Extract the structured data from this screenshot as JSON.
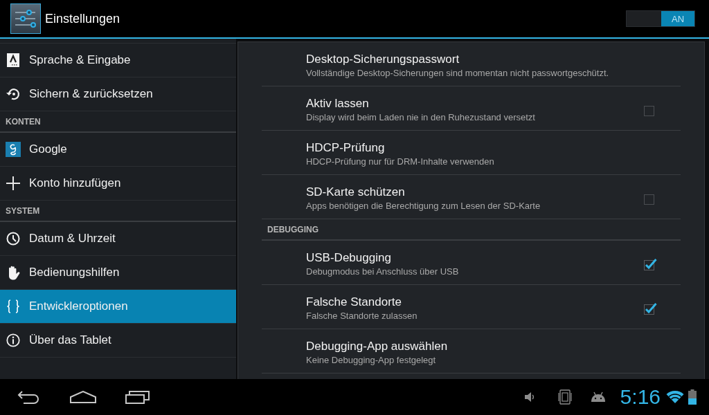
{
  "action_bar": {
    "title": "Einstellungen",
    "switch": {
      "label": "AN",
      "on": true
    }
  },
  "sidebar": {
    "items": [
      {
        "kind": "item",
        "label": "Sprache & Eingabe",
        "selected": false
      },
      {
        "kind": "item",
        "label": "Sichern & zurücksetzen",
        "selected": false
      },
      {
        "kind": "header",
        "label": "KONTEN"
      },
      {
        "kind": "item",
        "label": "Google",
        "selected": false
      },
      {
        "kind": "item",
        "label": "Konto hinzufügen",
        "selected": false
      },
      {
        "kind": "header",
        "label": "SYSTEM"
      },
      {
        "kind": "item",
        "label": "Datum & Uhrzeit",
        "selected": false
      },
      {
        "kind": "item",
        "label": "Bedienungshilfen",
        "selected": false
      },
      {
        "kind": "item",
        "label": "Entwickleroptionen",
        "selected": true
      },
      {
        "kind": "item",
        "label": "Über das Tablet",
        "selected": false
      }
    ]
  },
  "details": {
    "items": [
      {
        "kind": "action",
        "title": "Desktop-Sicherungspasswort",
        "summary": "Vollständige Desktop-Sicherungen sind momentan nicht passwortgeschützt."
      },
      {
        "kind": "checkbox",
        "title": "Aktiv lassen",
        "summary": "Display wird beim Laden nie in den Ruhezustand versetzt",
        "checked": false
      },
      {
        "kind": "action",
        "title": "HDCP-Prüfung",
        "summary": "HDCP-Prüfung nur für DRM-Inhalte verwenden"
      },
      {
        "kind": "checkbox",
        "title": "SD-Karte schützen",
        "summary": "Apps benötigen die Berechtigung zum Lesen der SD-Karte",
        "checked": false
      },
      {
        "kind": "header",
        "label": "DEBUGGING"
      },
      {
        "kind": "checkbox",
        "title": "USB-Debugging",
        "summary": "Debugmodus bei Anschluss über USB",
        "checked": true
      },
      {
        "kind": "checkbox",
        "title": "Falsche Standorte",
        "summary": "Falsche Standorte zulassen",
        "checked": true
      },
      {
        "kind": "action",
        "title": "Debugging-App auswählen",
        "summary": "Keine Debugging-App festgelegt"
      }
    ]
  },
  "navigation_bar": {
    "clock": "5:16"
  }
}
